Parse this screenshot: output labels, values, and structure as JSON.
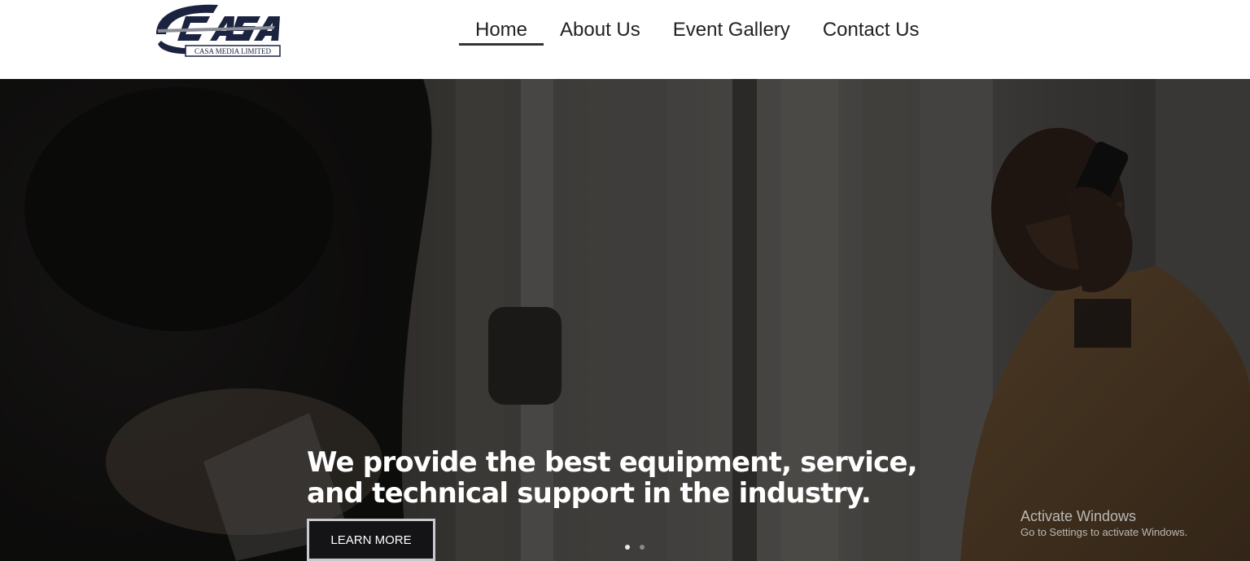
{
  "header": {
    "logo": {
      "text": "CASA",
      "subtitle": "CASA MEDIA LIMITED",
      "color": "#1b2340"
    },
    "nav": [
      {
        "label": "Home",
        "active": true
      },
      {
        "label": "About Us",
        "active": false
      },
      {
        "label": "Event Gallery",
        "active": false
      },
      {
        "label": "Contact Us",
        "active": false
      }
    ]
  },
  "hero": {
    "headline": "We provide the best equipment, service, and technical support in the industry.",
    "cta_label": "LEARN MORE",
    "slider": {
      "slides": 2,
      "active_index": 0
    },
    "overlay_color": "#1a1a1a"
  },
  "watermark": {
    "title": "Activate Windows",
    "subtitle": "Go to Settings to activate Windows."
  }
}
